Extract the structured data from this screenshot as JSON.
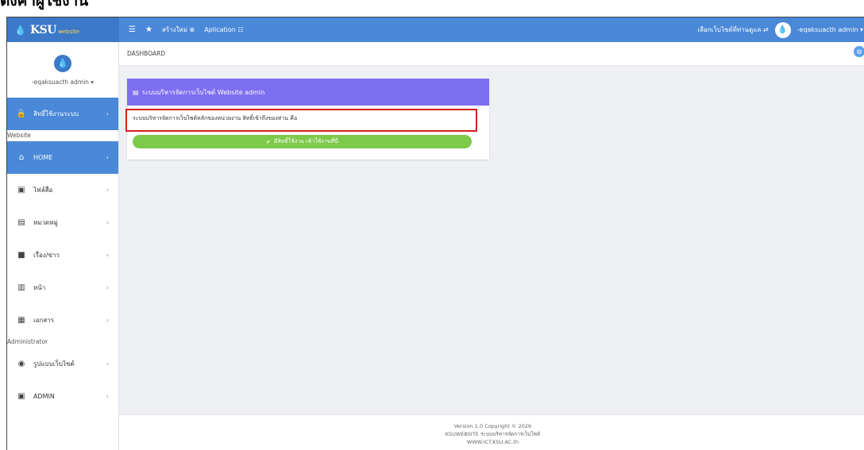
{
  "doc_title": "ตั้งค่าผู้ใช้งาน",
  "navbar": {
    "brand_name": "KSU",
    "brand_sub": "website",
    "menu_icon": "hamburger-icon",
    "tag_icon": "bookmark-icon",
    "create_label": "สร้างใหม่ ⊕",
    "application_label": "Aplication ☷",
    "choose_site_label": "เลือกเว็บไซต์ที่ท่านดูแล ⇄",
    "user_label": "-eqaksuacth admin ▾"
  },
  "sidebar": {
    "user_name": "-eqaksuacth admin ▾",
    "access_rights_item": {
      "label": "สิทธิ์ใช้งานระบบ",
      "icon": "lock-icon"
    },
    "section_website": "Website",
    "items": [
      {
        "label": "HOME",
        "icon": "home-icon"
      },
      {
        "label": "ไฟล์สื่อ",
        "icon": "image-icon"
      },
      {
        "label": "หมวดหมู่",
        "icon": "category-icon"
      },
      {
        "label": "เรื่อง/ข่าว",
        "icon": "news-icon"
      },
      {
        "label": "หน้า",
        "icon": "page-icon"
      },
      {
        "label": "เอกสาร",
        "icon": "document-icon"
      }
    ],
    "section_admin": "Administrator",
    "admin_items": [
      {
        "label": "รูปแบบเว็บไซต์",
        "icon": "palette-icon"
      },
      {
        "label": "ADMIN",
        "icon": "admin-icon"
      }
    ]
  },
  "content": {
    "breadcrumb": "DASHBOARD",
    "card_title": "ระบบบริหารจัดการเว็บไซต์ Website admin",
    "card_text": "ระบบบริหารจัดการเว็บไซต์หลักของหน่วยงาน สิทธิ์เข้าถึงของท่าน คือ",
    "access_button": "มีสิทธิ์ใช้งาน เข้าใช้งานที่นี่"
  },
  "footer": {
    "line1": "Version 1.0 Copyright © 2026",
    "line2": "KSUWEBSITE ระบบบริหารจัดการเว็บไซต์",
    "line3": "WWW.ICT.KSU.AC.th"
  },
  "colors": {
    "navbar": "#4a88d8",
    "active_item": "#4a88d8",
    "card_header": "#7e6ef0",
    "access_button": "#7dc94a",
    "highlight": "#d71f1f"
  }
}
